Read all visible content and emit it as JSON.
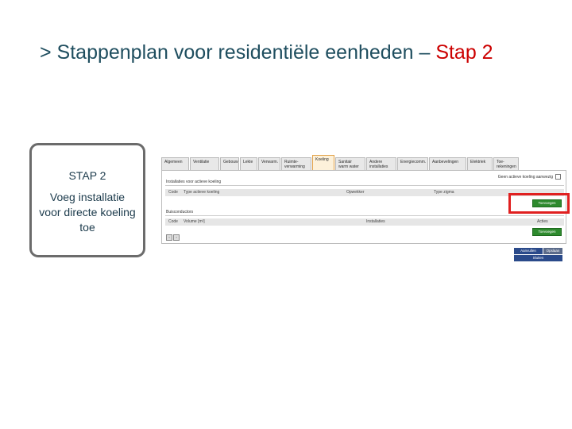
{
  "title": {
    "main": "> Stappenplan voor residentiële eenheden – ",
    "accent": "Stap 2"
  },
  "step": {
    "label": "STAP 2",
    "description": "Voeg installatie voor directe koeling toe"
  },
  "app": {
    "tabs": [
      {
        "label": "Algemeen"
      },
      {
        "label": "Ventilatie"
      },
      {
        "label": "Gebouw"
      },
      {
        "label": "Lekte"
      },
      {
        "label": "Verwarm."
      },
      {
        "label": "Ruimte-verwarming"
      },
      {
        "label": "Koeling"
      },
      {
        "label": "Sanitair warm water"
      },
      {
        "label": "Andere installaties"
      },
      {
        "label": "Energiecomm."
      },
      {
        "label": "Aanbevelingen"
      },
      {
        "label": "Elektriek"
      },
      {
        "label": "Toe-rekeningen"
      }
    ],
    "no_cooling_label": "Geen actieve koeling aanwezig",
    "section1_title": "Installaties voor actieve koeling",
    "table1_columns": [
      "Code",
      "Type actieve koeling",
      "Opwekker",
      "Type zigma"
    ],
    "add_button_label": "Toevoegen",
    "section2_title": "Buisconductors",
    "table2_columns": [
      "Code",
      "Volume [m³]",
      "Installaties",
      "Acties"
    ],
    "buttons": {
      "save": "Aanvullen",
      "help": "Opslaan",
      "close": "Sluiten"
    },
    "colors": {
      "active_tab": "#fdf1da",
      "add_button": "#2e8a2e",
      "highlight": "#e02020",
      "action_button": "#2a4a8a"
    }
  }
}
